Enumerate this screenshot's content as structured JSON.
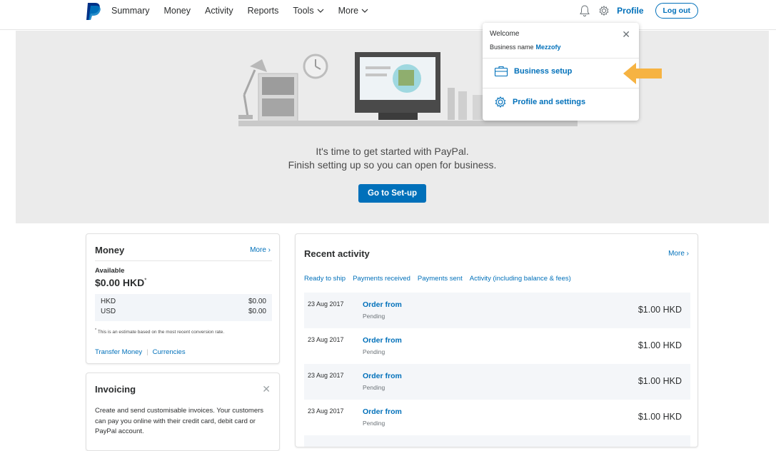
{
  "nav": {
    "items": [
      "Summary",
      "Money",
      "Activity",
      "Reports",
      "Tools",
      "More"
    ],
    "profile": "Profile",
    "logout": "Log out"
  },
  "hero": {
    "line1": "It's time to get started with PayPal.",
    "line2": "Finish setting up so you can open for business.",
    "button": "Go to Set-up"
  },
  "dropdown": {
    "welcome": "Welcome",
    "business_label": "Business name",
    "business_name": "Mezzofy",
    "item1": "Business setup",
    "item2": "Profile and settings"
  },
  "money": {
    "title": "Money",
    "more": "More",
    "available_label": "Available",
    "available_amount": "$0.00 HKD",
    "currencies": [
      {
        "code": "HKD",
        "amount": "$0.00"
      },
      {
        "code": "USD",
        "amount": "$0.00"
      }
    ],
    "note": "This is an estimate based on the most recent conversion rate.",
    "link1": "Transfer Money",
    "link2": "Currencies"
  },
  "invoicing": {
    "title": "Invoicing",
    "text": "Create and send customisable invoices. Your customers can pay you online with their credit card, debit card or PayPal account."
  },
  "activity": {
    "title": "Recent activity",
    "more": "More",
    "tabs": [
      "Ready to ship",
      "Payments received",
      "Payments sent",
      "Activity (including balance & fees)"
    ],
    "rows": [
      {
        "date": "23 Aug 2017",
        "title": "Order from",
        "status": "Pending",
        "amount": "$1.00 HKD"
      },
      {
        "date": "23 Aug 2017",
        "title": "Order from",
        "status": "Pending",
        "amount": "$1.00 HKD"
      },
      {
        "date": "23 Aug 2017",
        "title": "Order from",
        "status": "Pending",
        "amount": "$1.00 HKD"
      },
      {
        "date": "23 Aug 2017",
        "title": "Order from",
        "status": "Pending",
        "amount": "$1.00 HKD"
      }
    ]
  },
  "colors": {
    "brand_blue": "#0070ba",
    "hero_bg": "#ebebeb",
    "arrow": "#f6b342"
  }
}
